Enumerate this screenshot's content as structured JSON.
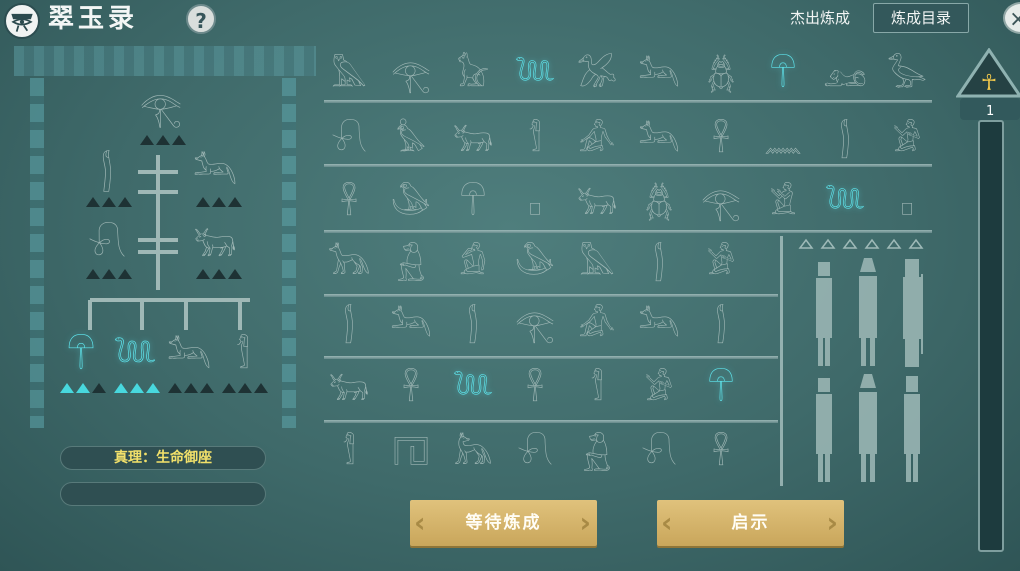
{
  "header": {
    "title": "翠玉录",
    "help_label": "?",
    "outstanding_label": "杰出炼成",
    "catalog_label": "炼成目录",
    "close_label": "×"
  },
  "left": {
    "truth_label": "真理：生命御座",
    "second_label": ""
  },
  "buttons": {
    "wait_label": "等待炼成",
    "hint_label": "启示"
  },
  "progress": {
    "level": "1",
    "ankh": "☥",
    "fraction": 0.0
  },
  "grid": {
    "rows": [
      [
        {
          "g": "𓅓",
          "on": false
        },
        {
          "g": "𓂀",
          "on": false
        },
        {
          "g": "𓃠",
          "on": false
        },
        {
          "g": "𓆙",
          "on": true
        },
        {
          "g": "𓅮",
          "on": false
        },
        {
          "g": "𓃢",
          "on": false
        },
        {
          "g": "𓆣",
          "on": false
        },
        {
          "g": "𓋻",
          "on": true
        },
        {
          "g": "𓃭",
          "on": false
        },
        {
          "g": "𓅭",
          "on": false
        }
      ],
      [
        {
          "g": "𓍯",
          "on": false
        },
        {
          "g": "𓅊",
          "on": false
        },
        {
          "g": "𓃒",
          "on": false
        },
        {
          "g": "𓀾",
          "on": false
        },
        {
          "g": "𓀉",
          "on": false
        },
        {
          "g": "𓃢",
          "on": false
        },
        {
          "g": "𓋹",
          "on": false
        },
        {
          "g": "𓈖",
          "on": false
        },
        {
          "g": "𓂭",
          "on": false
        },
        {
          "g": "𓀂",
          "on": false
        }
      ],
      [
        {
          "g": "𓋹",
          "on": false
        },
        {
          "g": "𓅇",
          "on": false
        },
        {
          "g": "𓋻",
          "on": false
        },
        {
          "g": "𓊪",
          "on": false
        },
        {
          "g": "𓃒",
          "on": false
        },
        {
          "g": "𓆣",
          "on": false
        },
        {
          "g": "𓂀",
          "on": false
        },
        {
          "g": "𓀃",
          "on": false
        },
        {
          "g": "𓆙",
          "on": true
        },
        {
          "g": "𓊪",
          "on": false
        }
      ],
      [
        {
          "g": "𓃥",
          "on": false
        },
        {
          "g": "𓃻",
          "on": false
        },
        {
          "g": "𓀁",
          "on": false
        },
        {
          "g": "𓅇",
          "on": false
        },
        {
          "g": "𓅓",
          "on": false
        },
        {
          "g": "𓂭",
          "on": false
        },
        {
          "g": "𓀂",
          "on": false
        }
      ],
      [
        {
          "g": "𓂭",
          "on": false
        },
        {
          "g": "𓃢",
          "on": false
        },
        {
          "g": "𓂭",
          "on": false
        },
        {
          "g": "𓂀",
          "on": false
        },
        {
          "g": "𓀉",
          "on": false
        },
        {
          "g": "𓃢",
          "on": false
        },
        {
          "g": "𓂭",
          "on": false
        }
      ],
      [
        {
          "g": "𓃒",
          "on": false
        },
        {
          "g": "𓋹",
          "on": false
        },
        {
          "g": "𓆙",
          "on": true
        },
        {
          "g": "𓋹",
          "on": false
        },
        {
          "g": "𓀾",
          "on": false
        },
        {
          "g": "𓀂",
          "on": false
        },
        {
          "g": "𓋻",
          "on": true
        }
      ],
      [
        {
          "g": "𓀾",
          "on": false
        },
        {
          "g": "𓉔",
          "on": false
        },
        {
          "g": "𓃦",
          "on": false
        },
        {
          "g": "𓍯",
          "on": false
        },
        {
          "g": "𓃻",
          "on": false
        },
        {
          "g": "𓍯",
          "on": false
        },
        {
          "g": "𓋹",
          "on": false
        }
      ]
    ]
  },
  "tree": {
    "top": {
      "g": "𓂀",
      "lit": 0
    },
    "mid_left": {
      "g": "𓂭",
      "lit": 0
    },
    "mid_right": {
      "g": "𓃢",
      "lit": 0
    },
    "low_left": {
      "g": "𓍯",
      "lit": 0
    },
    "low_right": {
      "g": "𓃒",
      "lit": 0
    },
    "leaves": [
      {
        "g": "𓋻",
        "lit": 2
      },
      {
        "g": "𓆙",
        "lit": 3
      },
      {
        "g": "𓃢",
        "lit": 0
      },
      {
        "g": "𓀾",
        "lit": 0
      }
    ]
  },
  "colors": {
    "accent": "#5fe6ee",
    "button": "#d4b36a",
    "truth_text": "#f1e06a"
  }
}
